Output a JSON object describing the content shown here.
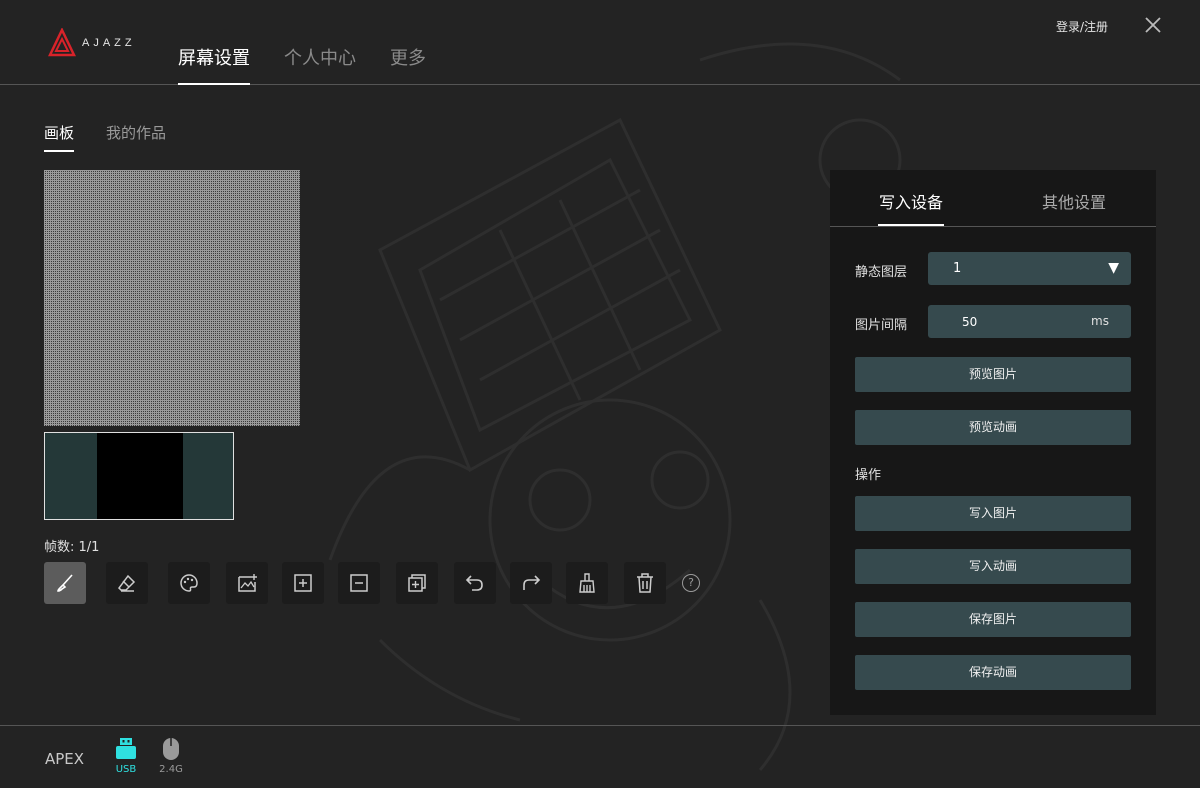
{
  "header": {
    "logo_text": "AJAZZ",
    "nav": [
      {
        "label": "屏幕设置",
        "active": true
      },
      {
        "label": "个人中心",
        "active": false
      },
      {
        "label": "更多",
        "active": false
      }
    ],
    "login_label": "登录/注册"
  },
  "subtabs": [
    {
      "label": "画板",
      "active": true
    },
    {
      "label": "我的作品",
      "active": false
    }
  ],
  "frames": {
    "count_label": "帧数: 1/1"
  },
  "tools": [
    {
      "name": "brush-tool",
      "icon": "brush-icon",
      "active": true
    },
    {
      "name": "eraser-tool",
      "icon": "eraser-icon",
      "active": false
    },
    {
      "name": "palette-tool",
      "icon": "palette-icon",
      "active": false
    },
    {
      "name": "image-import-tool",
      "icon": "image-add-icon",
      "active": false
    },
    {
      "name": "add-frame-tool",
      "icon": "plus-box-icon",
      "active": false
    },
    {
      "name": "remove-frame-tool",
      "icon": "minus-box-icon",
      "active": false
    },
    {
      "name": "copy-frame-tool",
      "icon": "copy-icon",
      "active": false
    },
    {
      "name": "undo-tool",
      "icon": "undo-icon",
      "active": false
    },
    {
      "name": "redo-tool",
      "icon": "redo-icon",
      "active": false
    },
    {
      "name": "clean-tool",
      "icon": "broom-icon",
      "active": false
    },
    {
      "name": "delete-tool",
      "icon": "trash-icon",
      "active": false
    }
  ],
  "panel": {
    "tabs": [
      {
        "label": "写入设备",
        "active": true
      },
      {
        "label": "其他设置",
        "active": false
      }
    ],
    "static_layer_label": "静态图层",
    "static_layer_value": "1",
    "interval_label": "图片间隔",
    "interval_value": "50",
    "interval_unit": "ms",
    "preview_image": "预览图片",
    "preview_animation": "预览动画",
    "operations_label": "操作",
    "write_image": "写入图片",
    "write_animation": "写入动画",
    "save_image": "保存图片",
    "save_animation": "保存动画"
  },
  "footer": {
    "device_name": "APEX",
    "connections": [
      {
        "label": "USB",
        "active": true,
        "color": "#2fe0e0"
      },
      {
        "label": "2.4G",
        "active": false,
        "color": "#9a9a9a"
      }
    ]
  },
  "colors": {
    "accent": "#2fe0e0",
    "button_bg": "#364a4e",
    "logo_red": "#d8232a"
  }
}
